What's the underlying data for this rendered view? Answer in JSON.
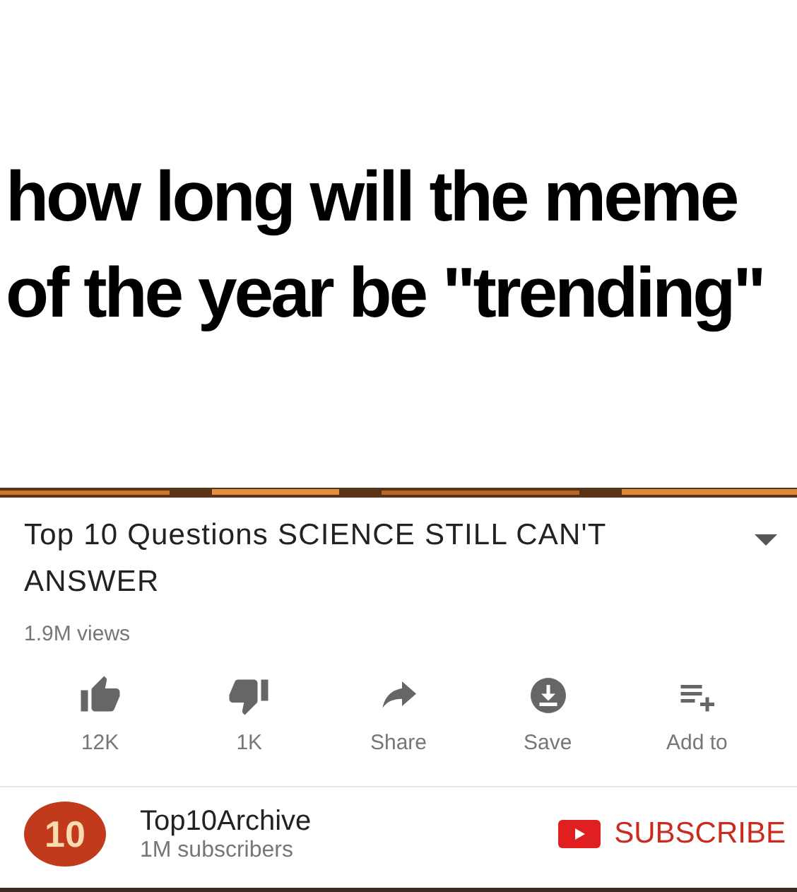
{
  "caption": {
    "lines": [
      "how long will the meme",
      "of the year be \"trending\""
    ]
  },
  "video": {
    "kind": "picture",
    "title": "Top 10 Questions SCIENCE STILL CAN'T ANSWER",
    "views": "1.9M views",
    "expanded": false
  },
  "actions": [
    {
      "kind": "like",
      "label": "12K"
    },
    {
      "kind": "dislike",
      "label": "1K"
    },
    {
      "kind": "share",
      "label": "Share"
    },
    {
      "kind": "save",
      "label": "Save"
    },
    {
      "kind": "add",
      "label": "Add to"
    }
  ],
  "channel": {
    "logo_text": "10",
    "name": "Top10Archive",
    "subscribers": "1M subscribers",
    "subscribe": "SUBSCRIBE"
  }
}
